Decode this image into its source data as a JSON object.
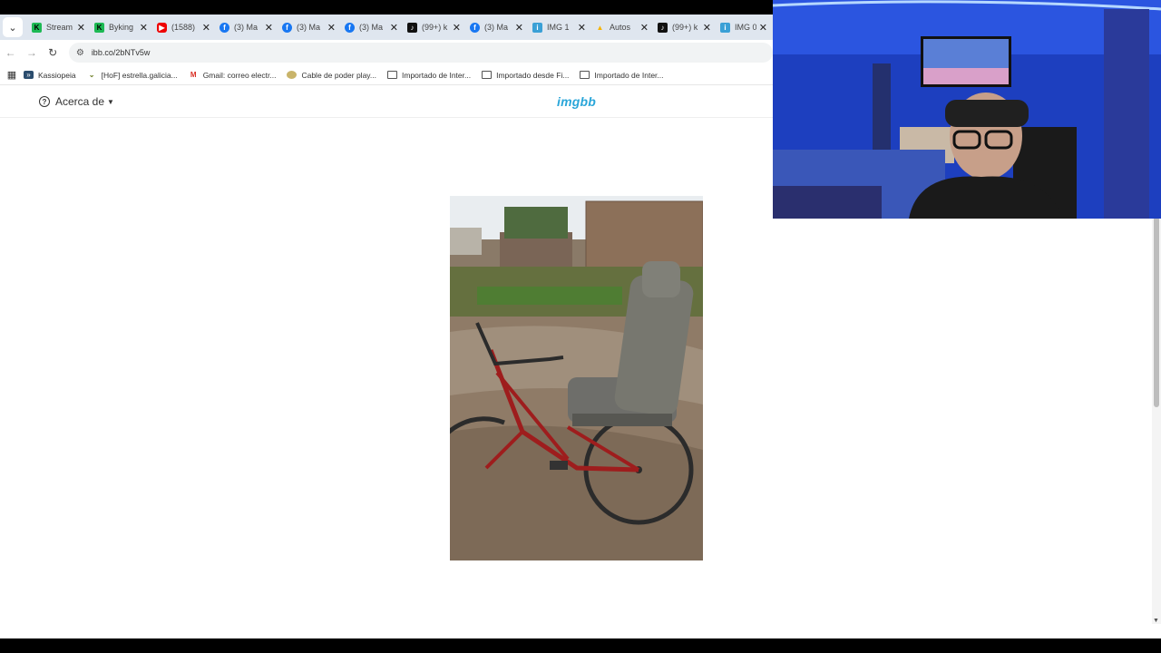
{
  "browser": {
    "tabs": [
      {
        "label": "Stream",
        "icon": "kick-icon"
      },
      {
        "label": "Byking",
        "icon": "kick-icon"
      },
      {
        "label": "(1588)",
        "icon": "youtube-icon"
      },
      {
        "label": "(3) Ma",
        "icon": "facebook-icon"
      },
      {
        "label": "(3) Ma",
        "icon": "facebook-icon"
      },
      {
        "label": "(3) Ma",
        "icon": "facebook-icon"
      },
      {
        "label": "(99+) k",
        "icon": "tiktok-icon"
      },
      {
        "label": "(3) Ma",
        "icon": "facebook-icon"
      },
      {
        "label": "IMG 1",
        "icon": "imgbb-icon"
      },
      {
        "label": "Autos",
        "icon": "drive-icon"
      },
      {
        "label": "(99+) k",
        "icon": "tiktok-icon"
      },
      {
        "label": "IMG 0",
        "icon": "imgbb-icon"
      }
    ],
    "url": "ibb.co/2bNTv5w",
    "bookmarks": [
      {
        "label": "Kassiopeia",
        "icon": "kassiopeia-icon"
      },
      {
        "label": "[HoF] estrella.galicia...",
        "icon": "hof-icon"
      },
      {
        "label": "Gmail: correo electr...",
        "icon": "gmail-icon"
      },
      {
        "label": "Cable de poder play...",
        "icon": "cable-icon"
      },
      {
        "label": "Importado de Inter...",
        "icon": "folder-icon"
      },
      {
        "label": "Importado desde Fi...",
        "icon": "folder-icon"
      },
      {
        "label": "Importado de Inter...",
        "icon": "folder-icon"
      }
    ]
  },
  "site": {
    "about_label": "Acerca de",
    "logo": "imgbb"
  }
}
